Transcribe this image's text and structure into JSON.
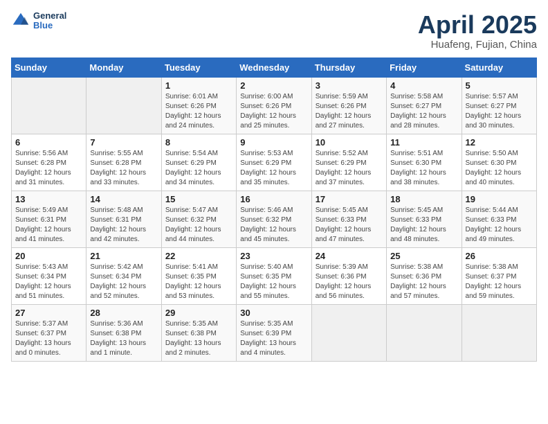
{
  "logo": {
    "text_general": "General",
    "text_blue": "Blue"
  },
  "title": "April 2025",
  "subtitle": "Huafeng, Fujian, China",
  "days_of_week": [
    "Sunday",
    "Monday",
    "Tuesday",
    "Wednesday",
    "Thursday",
    "Friday",
    "Saturday"
  ],
  "weeks": [
    [
      {
        "day": "",
        "empty": true
      },
      {
        "day": "",
        "empty": true
      },
      {
        "day": "1",
        "sunrise": "Sunrise: 6:01 AM",
        "sunset": "Sunset: 6:26 PM",
        "daylight": "Daylight: 12 hours and 24 minutes."
      },
      {
        "day": "2",
        "sunrise": "Sunrise: 6:00 AM",
        "sunset": "Sunset: 6:26 PM",
        "daylight": "Daylight: 12 hours and 25 minutes."
      },
      {
        "day": "3",
        "sunrise": "Sunrise: 5:59 AM",
        "sunset": "Sunset: 6:26 PM",
        "daylight": "Daylight: 12 hours and 27 minutes."
      },
      {
        "day": "4",
        "sunrise": "Sunrise: 5:58 AM",
        "sunset": "Sunset: 6:27 PM",
        "daylight": "Daylight: 12 hours and 28 minutes."
      },
      {
        "day": "5",
        "sunrise": "Sunrise: 5:57 AM",
        "sunset": "Sunset: 6:27 PM",
        "daylight": "Daylight: 12 hours and 30 minutes."
      }
    ],
    [
      {
        "day": "6",
        "sunrise": "Sunrise: 5:56 AM",
        "sunset": "Sunset: 6:28 PM",
        "daylight": "Daylight: 12 hours and 31 minutes."
      },
      {
        "day": "7",
        "sunrise": "Sunrise: 5:55 AM",
        "sunset": "Sunset: 6:28 PM",
        "daylight": "Daylight: 12 hours and 33 minutes."
      },
      {
        "day": "8",
        "sunrise": "Sunrise: 5:54 AM",
        "sunset": "Sunset: 6:29 PM",
        "daylight": "Daylight: 12 hours and 34 minutes."
      },
      {
        "day": "9",
        "sunrise": "Sunrise: 5:53 AM",
        "sunset": "Sunset: 6:29 PM",
        "daylight": "Daylight: 12 hours and 35 minutes."
      },
      {
        "day": "10",
        "sunrise": "Sunrise: 5:52 AM",
        "sunset": "Sunset: 6:29 PM",
        "daylight": "Daylight: 12 hours and 37 minutes."
      },
      {
        "day": "11",
        "sunrise": "Sunrise: 5:51 AM",
        "sunset": "Sunset: 6:30 PM",
        "daylight": "Daylight: 12 hours and 38 minutes."
      },
      {
        "day": "12",
        "sunrise": "Sunrise: 5:50 AM",
        "sunset": "Sunset: 6:30 PM",
        "daylight": "Daylight: 12 hours and 40 minutes."
      }
    ],
    [
      {
        "day": "13",
        "sunrise": "Sunrise: 5:49 AM",
        "sunset": "Sunset: 6:31 PM",
        "daylight": "Daylight: 12 hours and 41 minutes."
      },
      {
        "day": "14",
        "sunrise": "Sunrise: 5:48 AM",
        "sunset": "Sunset: 6:31 PM",
        "daylight": "Daylight: 12 hours and 42 minutes."
      },
      {
        "day": "15",
        "sunrise": "Sunrise: 5:47 AM",
        "sunset": "Sunset: 6:32 PM",
        "daylight": "Daylight: 12 hours and 44 minutes."
      },
      {
        "day": "16",
        "sunrise": "Sunrise: 5:46 AM",
        "sunset": "Sunset: 6:32 PM",
        "daylight": "Daylight: 12 hours and 45 minutes."
      },
      {
        "day": "17",
        "sunrise": "Sunrise: 5:45 AM",
        "sunset": "Sunset: 6:33 PM",
        "daylight": "Daylight: 12 hours and 47 minutes."
      },
      {
        "day": "18",
        "sunrise": "Sunrise: 5:45 AM",
        "sunset": "Sunset: 6:33 PM",
        "daylight": "Daylight: 12 hours and 48 minutes."
      },
      {
        "day": "19",
        "sunrise": "Sunrise: 5:44 AM",
        "sunset": "Sunset: 6:33 PM",
        "daylight": "Daylight: 12 hours and 49 minutes."
      }
    ],
    [
      {
        "day": "20",
        "sunrise": "Sunrise: 5:43 AM",
        "sunset": "Sunset: 6:34 PM",
        "daylight": "Daylight: 12 hours and 51 minutes."
      },
      {
        "day": "21",
        "sunrise": "Sunrise: 5:42 AM",
        "sunset": "Sunset: 6:34 PM",
        "daylight": "Daylight: 12 hours and 52 minutes."
      },
      {
        "day": "22",
        "sunrise": "Sunrise: 5:41 AM",
        "sunset": "Sunset: 6:35 PM",
        "daylight": "Daylight: 12 hours and 53 minutes."
      },
      {
        "day": "23",
        "sunrise": "Sunrise: 5:40 AM",
        "sunset": "Sunset: 6:35 PM",
        "daylight": "Daylight: 12 hours and 55 minutes."
      },
      {
        "day": "24",
        "sunrise": "Sunrise: 5:39 AM",
        "sunset": "Sunset: 6:36 PM",
        "daylight": "Daylight: 12 hours and 56 minutes."
      },
      {
        "day": "25",
        "sunrise": "Sunrise: 5:38 AM",
        "sunset": "Sunset: 6:36 PM",
        "daylight": "Daylight: 12 hours and 57 minutes."
      },
      {
        "day": "26",
        "sunrise": "Sunrise: 5:38 AM",
        "sunset": "Sunset: 6:37 PM",
        "daylight": "Daylight: 12 hours and 59 minutes."
      }
    ],
    [
      {
        "day": "27",
        "sunrise": "Sunrise: 5:37 AM",
        "sunset": "Sunset: 6:37 PM",
        "daylight": "Daylight: 13 hours and 0 minutes."
      },
      {
        "day": "28",
        "sunrise": "Sunrise: 5:36 AM",
        "sunset": "Sunset: 6:38 PM",
        "daylight": "Daylight: 13 hours and 1 minute."
      },
      {
        "day": "29",
        "sunrise": "Sunrise: 5:35 AM",
        "sunset": "Sunset: 6:38 PM",
        "daylight": "Daylight: 13 hours and 2 minutes."
      },
      {
        "day": "30",
        "sunrise": "Sunrise: 5:35 AM",
        "sunset": "Sunset: 6:39 PM",
        "daylight": "Daylight: 13 hours and 4 minutes."
      },
      {
        "day": "",
        "empty": true
      },
      {
        "day": "",
        "empty": true
      },
      {
        "day": "",
        "empty": true
      }
    ]
  ]
}
